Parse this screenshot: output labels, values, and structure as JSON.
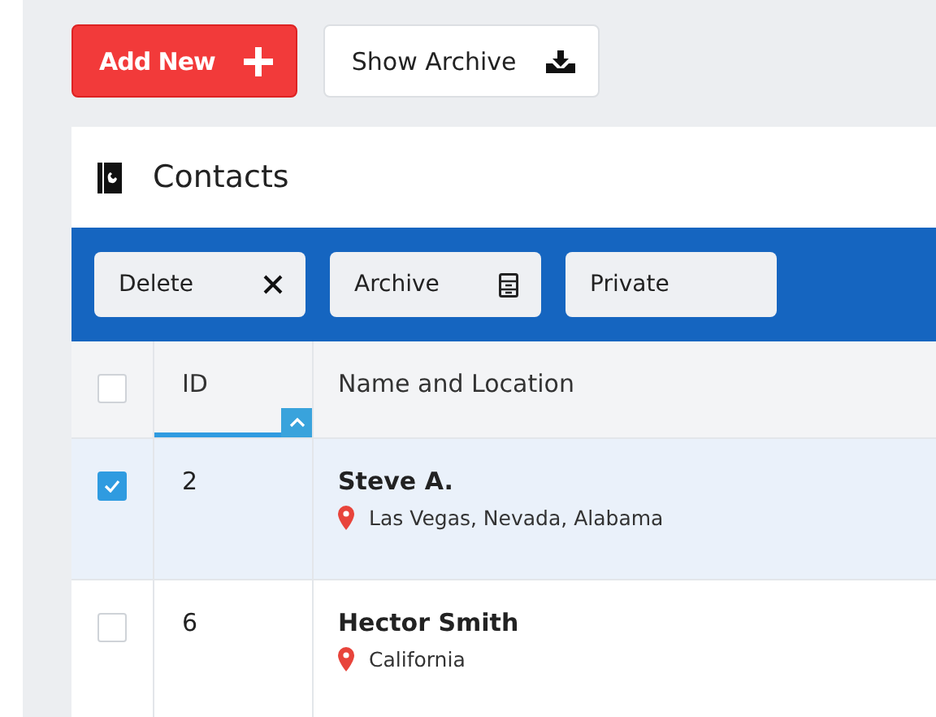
{
  "actions": [
    {
      "label": "Add New",
      "kind": "primary"
    },
    {
      "label": "Show Archive",
      "kind": "secondary"
    }
  ],
  "card": {
    "title": "Contacts"
  },
  "toolbar": [
    {
      "label": "Delete",
      "kind": "delete"
    },
    {
      "label": "Archive",
      "kind": "archive"
    },
    {
      "label": "Private",
      "kind": "plain"
    }
  ],
  "table": {
    "select_all": {
      "checked": false
    },
    "columns": [
      {
        "label": "ID",
        "sorted": true
      },
      {
        "label": "Name and Location",
        "sorted": false
      }
    ],
    "rows": [
      {
        "checked": true,
        "id": "2",
        "name": "Steve A.",
        "location": "Las Vegas, Nevada, Alabama"
      },
      {
        "checked": false,
        "id": "6",
        "name": "Hector Smith",
        "location": "California"
      }
    ]
  }
}
